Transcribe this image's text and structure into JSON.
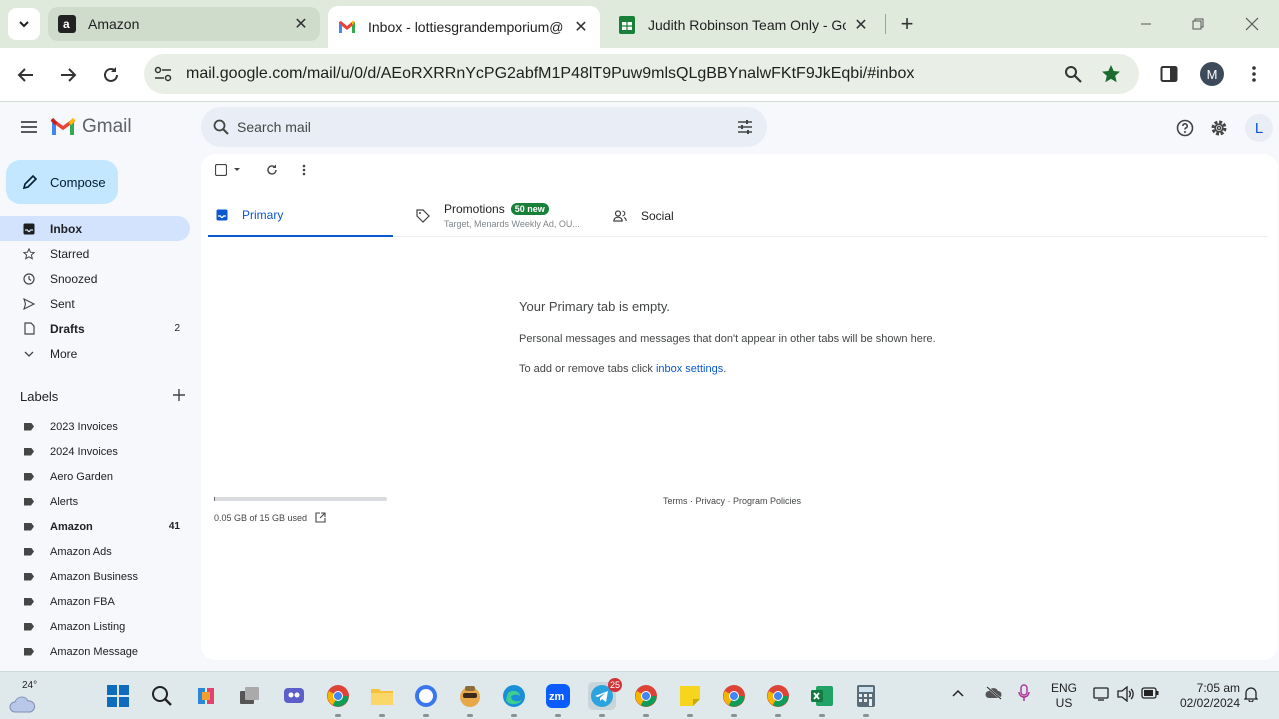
{
  "browser": {
    "tabs": [
      {
        "title": "Amazon",
        "favicon": "amazon-icon",
        "active": false
      },
      {
        "title": "Inbox - lottiesgrandemporium@",
        "favicon": "gmail-icon",
        "active": true
      },
      {
        "title": "Judith Robinson Team Only - Go",
        "favicon": "sheets-icon",
        "active": false
      }
    ],
    "url": "mail.google.com/mail/u/0/d/AEoRXRRnYcPG2abfM1P48lT9Puw9mlsQLgBBYnalwFKtF9JkEqbi/#inbox",
    "profile_initial": "M"
  },
  "gmail": {
    "brand": "Gmail",
    "search_placeholder": "Search mail",
    "account_initial": "L",
    "compose_label": "Compose",
    "nav": [
      {
        "label": "Inbox",
        "icon": "inbox-icon",
        "count": "",
        "active": true
      },
      {
        "label": "Starred",
        "icon": "star-icon",
        "count": "",
        "active": false
      },
      {
        "label": "Snoozed",
        "icon": "clock-icon",
        "count": "",
        "active": false
      },
      {
        "label": "Sent",
        "icon": "send-icon",
        "count": "",
        "active": false
      },
      {
        "label": "Drafts",
        "icon": "draft-icon",
        "count": "2",
        "active": false
      },
      {
        "label": "More",
        "icon": "chevron-down-icon",
        "count": "",
        "active": false
      }
    ],
    "labels_title": "Labels",
    "labels": [
      {
        "label": "2023 Invoices",
        "count": ""
      },
      {
        "label": "2024 Invoices",
        "count": ""
      },
      {
        "label": "Aero Garden",
        "count": ""
      },
      {
        "label": "Alerts",
        "count": ""
      },
      {
        "label": "Amazon",
        "count": "41"
      },
      {
        "label": "Amazon Ads",
        "count": ""
      },
      {
        "label": "Amazon Business",
        "count": ""
      },
      {
        "label": "Amazon FBA",
        "count": ""
      },
      {
        "label": "Amazon Listing",
        "count": ""
      },
      {
        "label": "Amazon Message",
        "count": ""
      }
    ],
    "inbox_tabs": {
      "primary": "Primary",
      "promotions": "Promotions",
      "promotions_badge": "50 new",
      "promotions_sub": "Target, Menards Weekly Ad, OU...",
      "social": "Social"
    },
    "empty": {
      "heading": "Your Primary tab is empty.",
      "body": "Personal messages and messages that don't appear in other tabs will be shown here.",
      "settings_prefix": "To add or remove tabs click ",
      "settings_link": "inbox settings",
      "settings_suffix": "."
    },
    "storage": {
      "text": "0.05 GB of 15 GB used",
      "fraction": 0.0033
    },
    "footer": "Terms · Privacy · Program Policies"
  },
  "taskbar": {
    "temperature": "24°",
    "telegram_badge": "25",
    "lang_top": "ENG",
    "lang_bottom": "US",
    "time": "7:05 am",
    "date": "02/02/2024"
  },
  "colors": {
    "chrome_bg": "#dfe9dc",
    "accent": "#0b57d0",
    "compose_bg": "#c2e7ff",
    "nav_active": "#d3e3fd",
    "badge_green": "#188038"
  }
}
